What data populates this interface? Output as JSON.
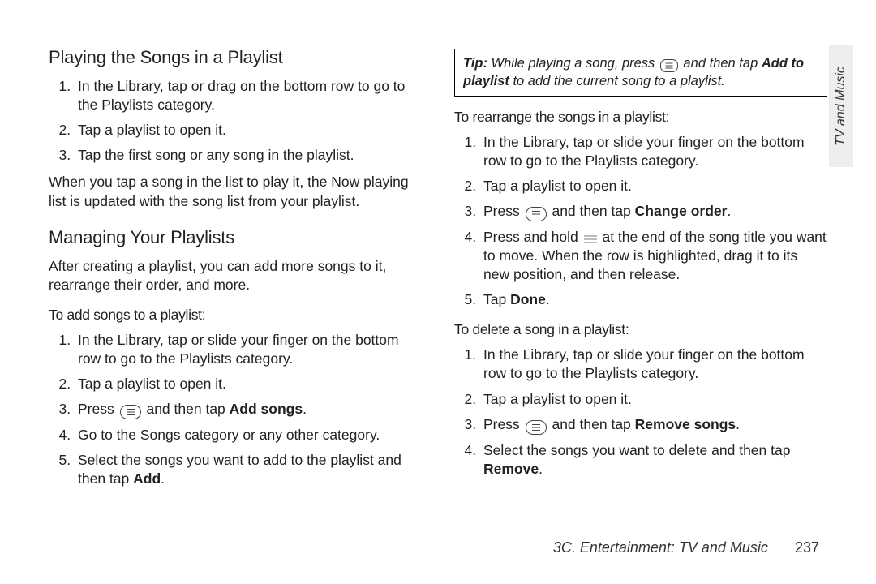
{
  "left": {
    "heading1": "Playing the Songs in a Playlist",
    "list1": [
      "In the Library, tap or drag on the bottom row to go to the Playlists category.",
      "Tap a playlist to open it.",
      "Tap the first song or any song in the playlist."
    ],
    "afterList1": "When you tap a song in the list to play it, the Now playing list is updated with the song list from your playlist.",
    "heading2": "Managing Your Playlists",
    "afterHeading2": "After creating a playlist, you can add more songs to it, rearrange their order, and more.",
    "subhead1": "To add songs to a playlist:",
    "list2_item1": "In the Library, tap or slide your finger on the bottom row to go to the Playlists category.",
    "list2_item2": "Tap a playlist to open it.",
    "list2_item3_pre": "Press ",
    "list2_item3_mid": " and then tap ",
    "list2_item3_bold": "Add songs",
    "list2_item3_post": ".",
    "list2_item4": "Go to the Songs category or any other category.",
    "list2_item5_pre": "Select the songs you want to add to the playlist and then tap ",
    "list2_item5_bold": "Add",
    "list2_item5_post": "."
  },
  "right": {
    "tip_label": "Tip:",
    "tip_pre": " While playing a song, press ",
    "tip_mid": " and then tap ",
    "tip_bold": "Add to playlist",
    "tip_post": " to add the current song to a playlist.",
    "subhead2": "To rearrange the songs in a playlist:",
    "list3_item1": "In the Library, tap or slide your finger on the bottom row to go to the Playlists category.",
    "list3_item2": "Tap a playlist to open it.",
    "list3_item3_pre": "Press ",
    "list3_item3_mid": " and then tap ",
    "list3_item3_bold": "Change order",
    "list3_item3_post": ".",
    "list3_item4_pre": "Press and hold ",
    "list3_item4_post": " at the end of the song title you want to move. When the row is highlighted, drag it to its new position, and then release.",
    "list3_item5_pre": "Tap ",
    "list3_item5_bold": "Done",
    "list3_item5_post": ".",
    "subhead3": "To delete a song in a playlist:",
    "list4_item1": "In the Library, tap or slide your finger on the bottom row to go to the Playlists category.",
    "list4_item2": "Tap a playlist to open it.",
    "list4_item3_pre": "Press ",
    "list4_item3_mid": " and then tap ",
    "list4_item3_bold": "Remove songs",
    "list4_item3_post": ".",
    "list4_item4_pre": "Select the songs you want to delete and then tap ",
    "list4_item4_bold": "Remove",
    "list4_item4_post": "."
  },
  "sideTab": "TV and Music",
  "footer": {
    "chapter": "3C. Entertainment: TV and Music",
    "page": "237"
  }
}
